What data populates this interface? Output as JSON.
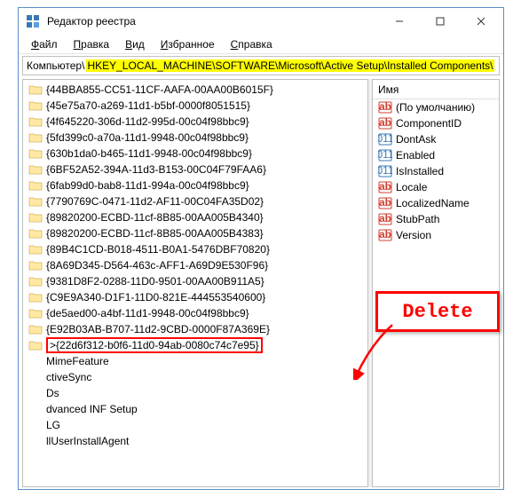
{
  "window": {
    "title": "Редактор реестра"
  },
  "menu": {
    "file": "Файл",
    "edit": "Правка",
    "view": "Вид",
    "favorites": "Избранное",
    "help": "Справка"
  },
  "path": {
    "prefix": "Компьютер\\",
    "highlight": "HKEY_LOCAL_MACHINE\\SOFTWARE\\Microsoft\\Active Setup\\Installed Components\\"
  },
  "tree": [
    {
      "label": "{44BBA855-CC51-11CF-AAFA-00AA00B6015F}",
      "icon": true
    },
    {
      "label": "{45e75a70-a269-11d1-b5bf-0000f8051515}",
      "icon": true
    },
    {
      "label": "{4f645220-306d-11d2-995d-00c04f98bbc9}",
      "icon": true
    },
    {
      "label": "{5fd399c0-a70a-11d1-9948-00c04f98bbc9}",
      "icon": true
    },
    {
      "label": "{630b1da0-b465-11d1-9948-00c04f98bbc9}",
      "icon": true
    },
    {
      "label": "{6BF52A52-394A-11d3-B153-00C04F79FAA6}",
      "icon": true
    },
    {
      "label": "{6fab99d0-bab8-11d1-994a-00c04f98bbc9}",
      "icon": true
    },
    {
      "label": "{7790769C-0471-11d2-AF11-00C04FA35D02}",
      "icon": true
    },
    {
      "label": "{89820200-ECBD-11cf-8B85-00AA005B4340}",
      "icon": true
    },
    {
      "label": "{89820200-ECBD-11cf-8B85-00AA005B4383}",
      "icon": true
    },
    {
      "label": "{89B4C1CD-B018-4511-B0A1-5476DBF70820}",
      "icon": true
    },
    {
      "label": "{8A69D345-D564-463c-AFF1-A69D9E530F96}",
      "icon": true
    },
    {
      "label": "{9381D8F2-0288-11D0-9501-00AA00B911A5}",
      "icon": true
    },
    {
      "label": "{C9E9A340-D1F1-11D0-821E-444553540600}",
      "icon": true
    },
    {
      "label": "{de5aed00-a4bf-11d1-9948-00c04f98bbc9}",
      "icon": true
    },
    {
      "label": "{E92B03AB-B707-11d2-9CBD-0000F87A369E}",
      "icon": true
    },
    {
      "label": ">{22d6f312-b0f6-11d0-94ab-0080c74c7e95}",
      "icon": true,
      "selected": true
    },
    {
      "label": "MimeFeature",
      "icon": false
    },
    {
      "label": "ctiveSync",
      "icon": false
    },
    {
      "label": "Ds",
      "icon": false
    },
    {
      "label": "dvanced INF Setup",
      "icon": false
    },
    {
      "label": "LG",
      "icon": false
    },
    {
      "label": "llUserInstallAgent",
      "icon": false
    }
  ],
  "values": {
    "col_name": "Имя",
    "items": [
      {
        "name": "(По умолчанию)",
        "type": "sz"
      },
      {
        "name": "ComponentID",
        "type": "sz"
      },
      {
        "name": "DontAsk",
        "type": "bin"
      },
      {
        "name": "Enabled",
        "type": "bin"
      },
      {
        "name": "IsInstalled",
        "type": "bin"
      },
      {
        "name": "Locale",
        "type": "sz"
      },
      {
        "name": "LocalizedName",
        "type": "sz"
      },
      {
        "name": "StubPath",
        "type": "sz"
      },
      {
        "name": "Version",
        "type": "sz"
      }
    ]
  },
  "annotation": {
    "label": "Delete"
  }
}
